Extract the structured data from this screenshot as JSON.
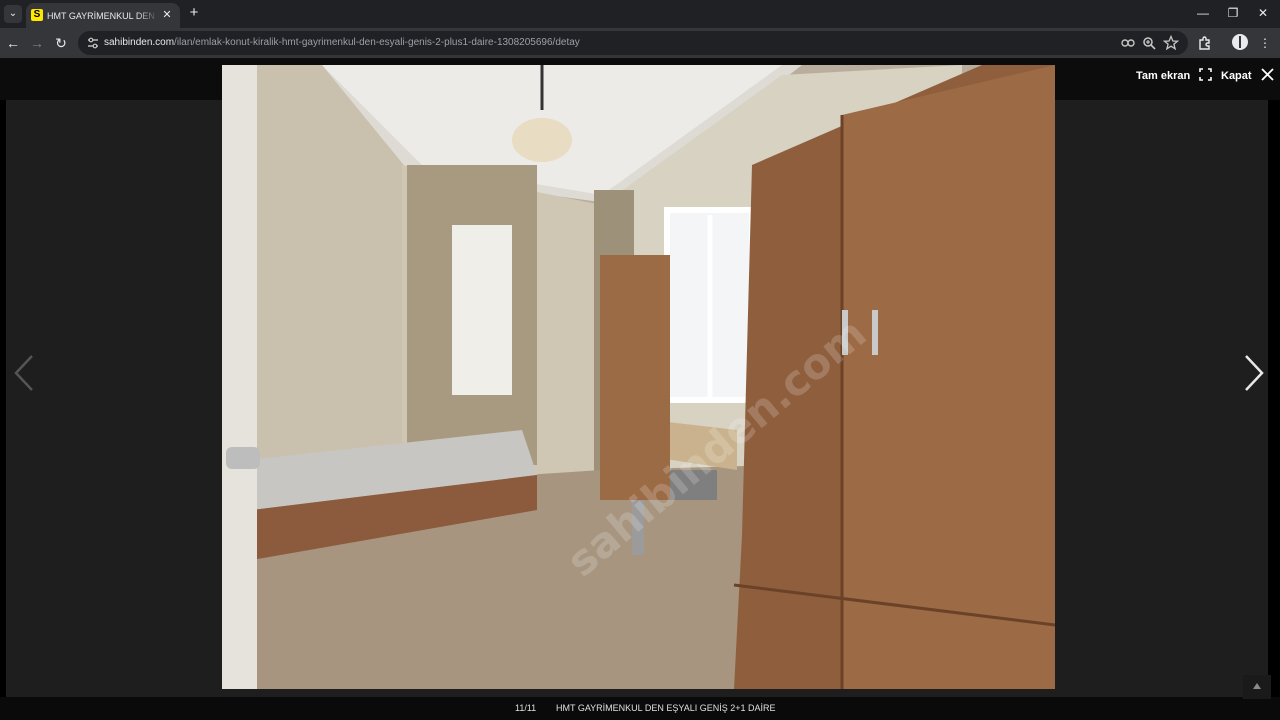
{
  "browser": {
    "tab": {
      "favicon_letter": "S",
      "title": "HMT GAYRİMENKUL DEN EŞYALI GENİŞ 2+1 DAİRE",
      "close_glyph": "✕"
    },
    "new_tab_glyph": "+",
    "window_controls": {
      "minimize": "—",
      "restore": "❐",
      "close": "✕"
    },
    "nav": {
      "back": "←",
      "forward": "→",
      "reload": "↻"
    },
    "address": {
      "host": "sahibinden.com",
      "path": "/ilan/emlak-konut-kiralik-hmt-gayrimenkul-den-esyali-genis-2-plus1-daire-1308205696/detay"
    }
  },
  "lightbox": {
    "fullscreen_label": "Tam ekran",
    "close_label": "Kapat",
    "counter": "11/11",
    "caption": "HMT GAYRİMENKUL DEN EŞYALI GENİŞ 2+1 DAİRE",
    "watermark": "sahibinden.com",
    "photo_description_icon": "bedroom-photo"
  },
  "colors": {
    "accent_yellow": "#ffe800",
    "chrome_dark": "#202124",
    "chrome_toolbar": "#35363a",
    "lightbox_bg": "#000000"
  }
}
